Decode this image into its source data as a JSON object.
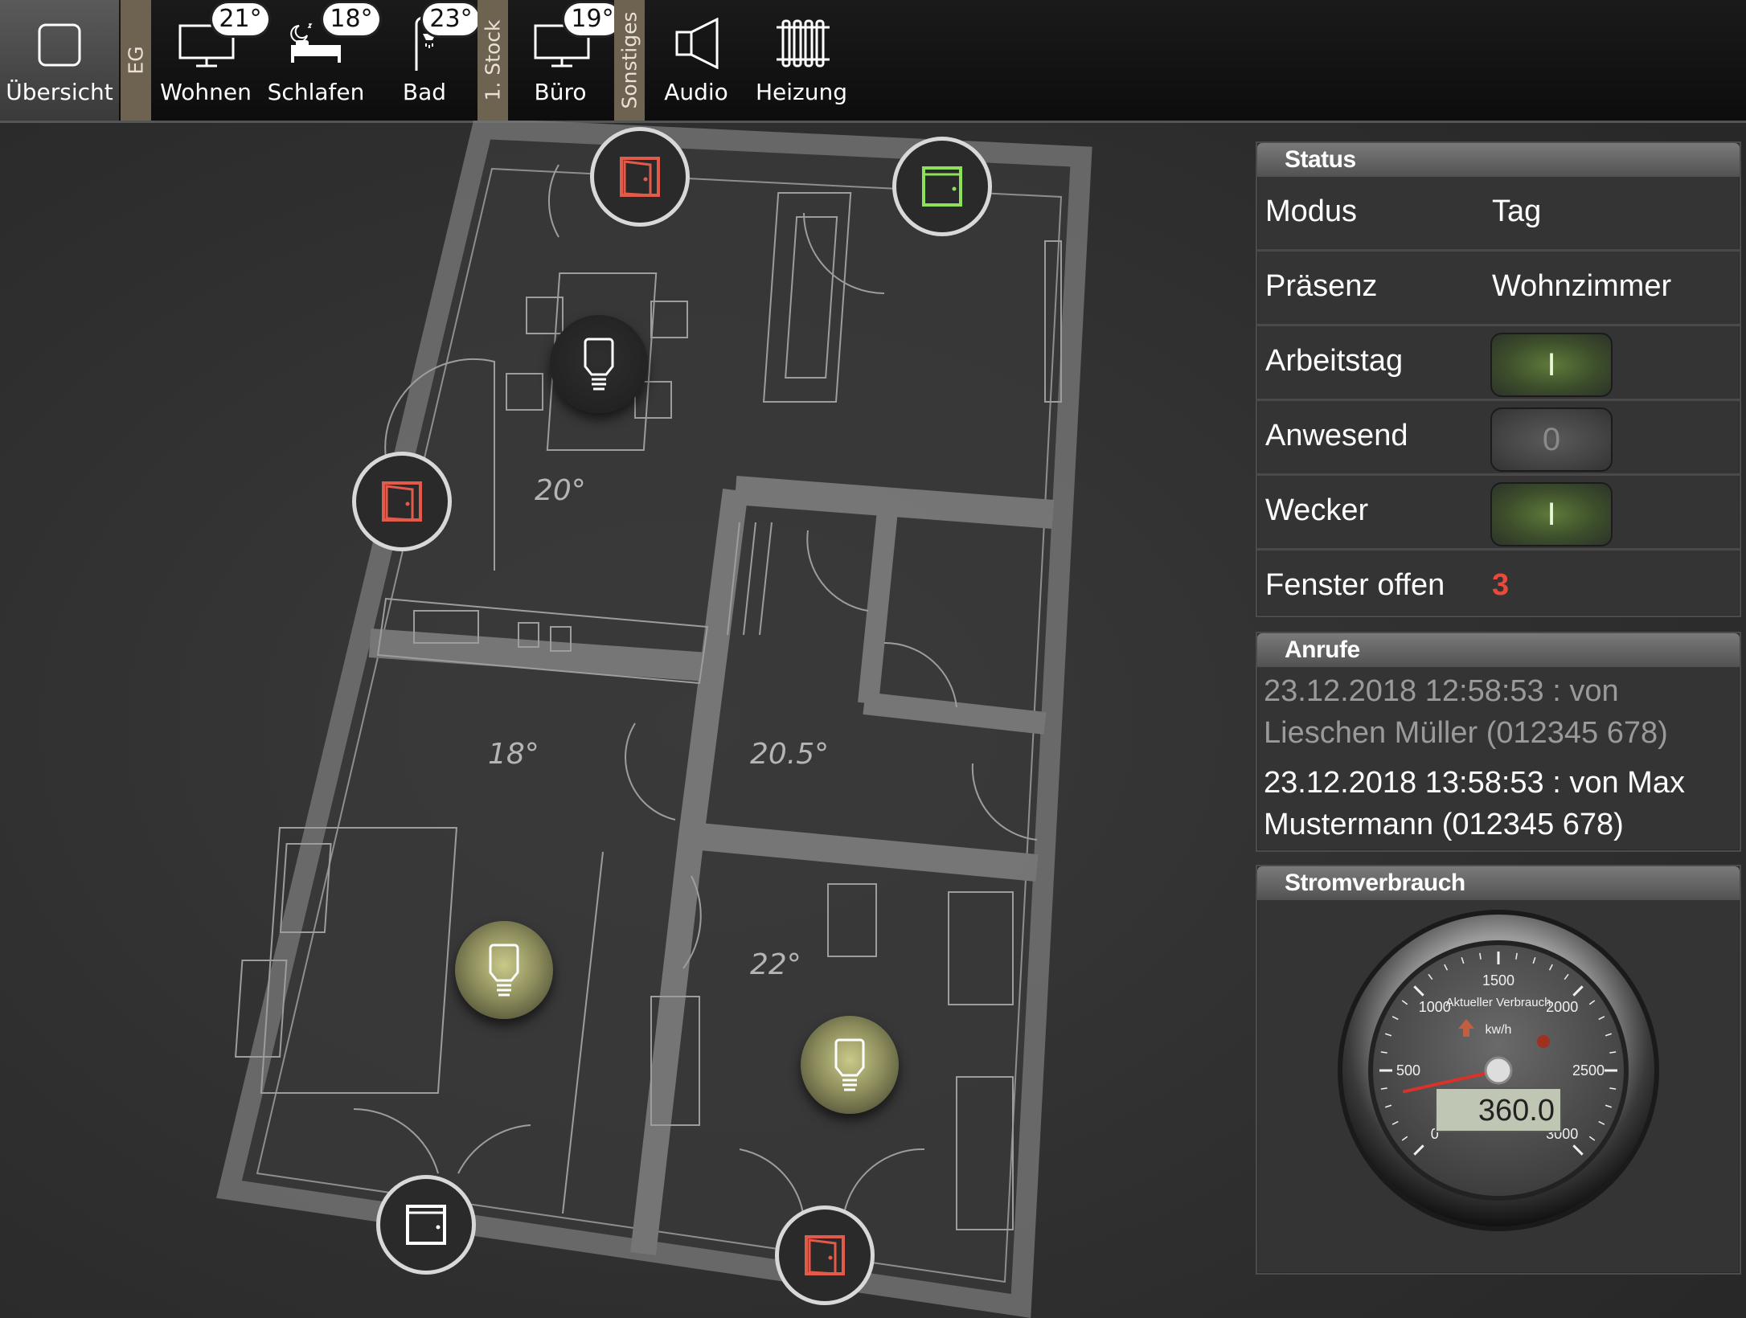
{
  "nav": {
    "overview": "Übersicht",
    "floor_eg": "EG",
    "rooms_eg": [
      {
        "label": "Wohnen",
        "temp": "21°"
      },
      {
        "label": "Schlafen",
        "temp": "18°"
      },
      {
        "label": "Bad",
        "temp": "23°"
      }
    ],
    "floor_1": "1. Stock",
    "rooms_1": [
      {
        "label": "Büro",
        "temp": "19°"
      }
    ],
    "floor_misc": "Sonstiges",
    "misc": [
      {
        "label": "Audio"
      },
      {
        "label": "Heizung"
      }
    ]
  },
  "plan": {
    "room_temps": [
      "20°",
      "18°",
      "20.5°",
      "22°"
    ],
    "colors": {
      "window_open": "#e25a4a",
      "window_closed_green": "#8ee05a",
      "window_closed": "#ffffff"
    },
    "devices": [
      {
        "icon": "window-open-icon",
        "state": "open"
      },
      {
        "icon": "window-closed-icon",
        "state": "closed-green"
      },
      {
        "icon": "window-open-icon",
        "state": "open"
      },
      {
        "icon": "window-closed-icon",
        "state": "closed"
      },
      {
        "icon": "window-open-icon",
        "state": "open"
      }
    ],
    "lamps": [
      {
        "icon": "bulb-icon",
        "state": "off"
      },
      {
        "icon": "bulb-icon",
        "state": "on"
      },
      {
        "icon": "bulb-icon",
        "state": "on"
      }
    ]
  },
  "status": {
    "title": "Status",
    "modus_label": "Modus",
    "modus_value": "Tag",
    "praesenz_label": "Präsenz",
    "praesenz_value": "Wohnzimmer",
    "arbeitstag_label": "Arbeitstag",
    "arbeitstag_value": "I",
    "anwesend_label": "Anwesend",
    "anwesend_value": "0",
    "wecker_label": "Wecker",
    "wecker_value": "I",
    "fenster_label": "Fenster offen",
    "fenster_value": "3",
    "fenster_color": "#e84b3c"
  },
  "calls": {
    "title": "Anrufe",
    "entries": [
      "23.12.2018 12:58:53 : von Lieschen Müller (012345 678)",
      "23.12.2018 13:58:53 : von Max Mustermann (012345 678)"
    ]
  },
  "power": {
    "title": "Stromverbrauch",
    "gauge_title": "Aktueller Verbrauch",
    "unit": "kw/h",
    "value": "360.0",
    "value_num": 360,
    "ticks": [
      "0",
      "500",
      "1000",
      "1500",
      "2000",
      "2500",
      "3000"
    ]
  }
}
